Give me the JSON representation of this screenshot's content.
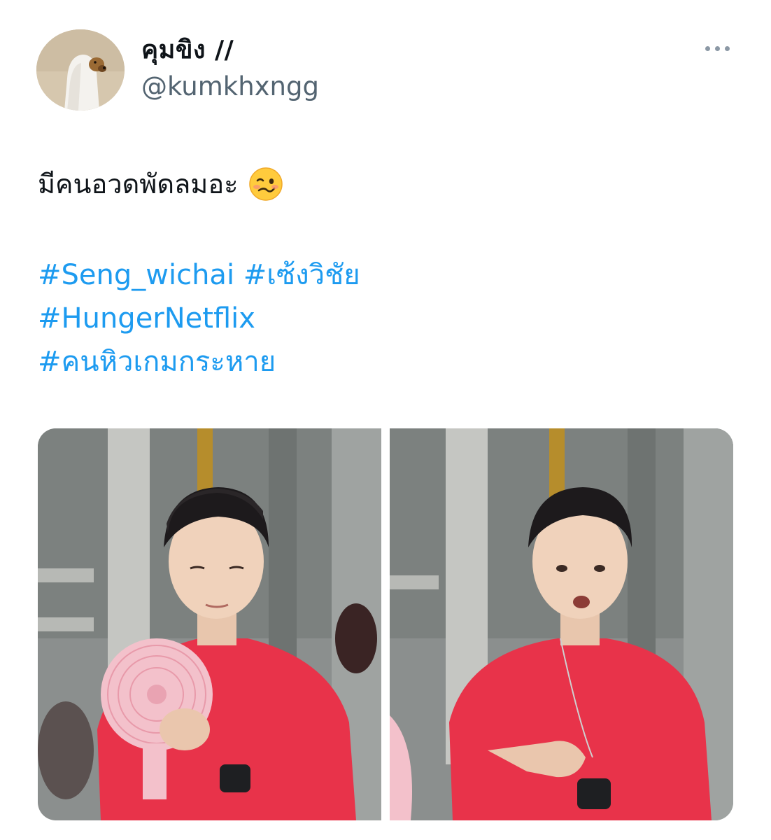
{
  "author": {
    "display_name": "คุมขิง //",
    "handle": "@kumkhxngg",
    "avatar_icon": "ghost-dog-avatar"
  },
  "tweet": {
    "text": "มีคนอวดพัดลมอะ",
    "emoji_icon": "woozy-face-emoji",
    "hashtag_lines": [
      [
        "#Seng_wichai",
        "#เซ้งวิชัย"
      ],
      [
        "#HungerNetflix"
      ],
      [
        "#คนหิวเกมกระหาย"
      ]
    ]
  },
  "media": {
    "photos": [
      {
        "description_icon": "man-holding-pink-fan-photo"
      },
      {
        "description_icon": "man-pointing-at-fan-photo"
      }
    ]
  },
  "colors": {
    "hashtag": "#1d9bf0",
    "handle": "#536471",
    "shirt": "#e8334a"
  }
}
